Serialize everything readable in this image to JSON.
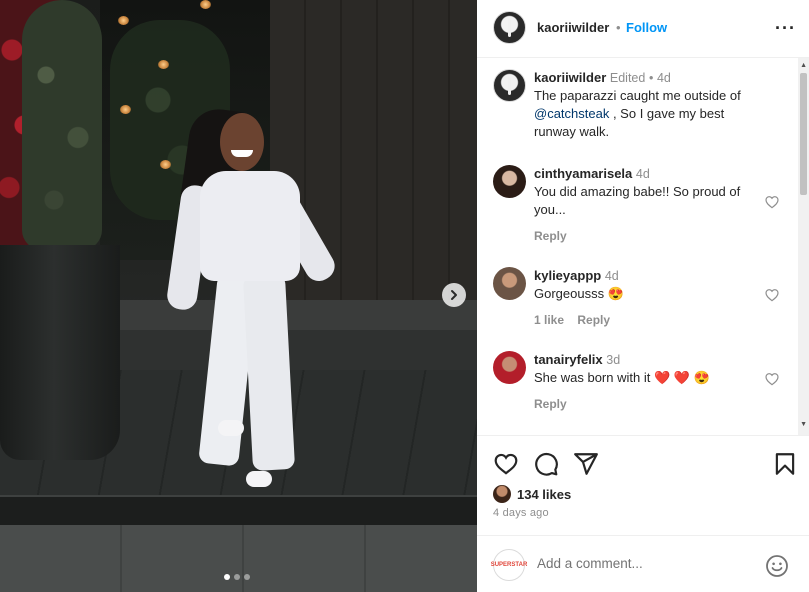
{
  "post": {
    "author": "kaoriiwilder",
    "separator": "•",
    "follow_label": "Follow",
    "more_label": "···"
  },
  "caption": {
    "username": "kaoriiwilder",
    "edited": "Edited",
    "dot": "•",
    "age": "4d",
    "text_before": "The paparazzi caught me outside of ",
    "mention": "@catchsteak",
    "text_after": " , So I gave my best runway walk."
  },
  "comments": [
    {
      "username": "cinthyamarisela",
      "age": "4d",
      "text": "You did amazing babe!! So proud of you...",
      "reply_label": "Reply",
      "likes": ""
    },
    {
      "username": "kylieyappp",
      "age": "4d",
      "text": "Gorgeousss 😍",
      "reply_label": "Reply",
      "likes": "1 like"
    },
    {
      "username": "tanairyfelix",
      "age": "3d",
      "text": "She was born with it ❤️ ❤️ 😍",
      "reply_label": "Reply",
      "likes": ""
    }
  ],
  "stats": {
    "likes": "134 likes",
    "time": "4 days ago"
  },
  "add_comment": {
    "placeholder": "Add a comment...",
    "avatar_text": "SUPERSTAR"
  },
  "carousel": {
    "count": 3,
    "active_index": 0
  },
  "icons": {
    "heart": "heart-icon",
    "comment": "comment-icon",
    "share": "share-icon",
    "save": "bookmark-icon",
    "emoji": "emoji-icon",
    "next": "chevron-right-icon"
  }
}
